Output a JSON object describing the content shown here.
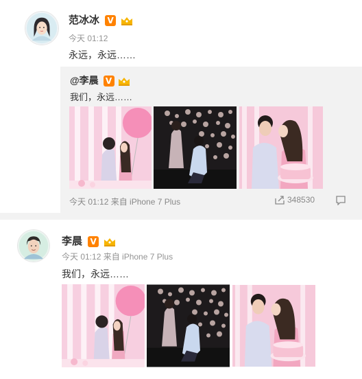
{
  "post1": {
    "author": "范冰冰",
    "verified_badge": "V",
    "timestamp": "今天 01:12",
    "text": "永远，永远……",
    "repost": {
      "author": "@李晨",
      "verified_badge": "V",
      "text": "我们，永远……",
      "footer": "今天 01:12  来自 iPhone 7 Plus",
      "share_count": "348530"
    }
  },
  "post2": {
    "author": "李晨",
    "verified_badge": "V",
    "meta": "今天 01:12 来自 iPhone 7 Plus",
    "text": "我们，永远……"
  },
  "colors": {
    "verified": "#ff8200",
    "repost_bg": "#f2f2f2",
    "meta": "#939393"
  },
  "icons": [
    "verified-badge-icon",
    "vip-crown-icon",
    "share-icon",
    "comment-icon"
  ]
}
